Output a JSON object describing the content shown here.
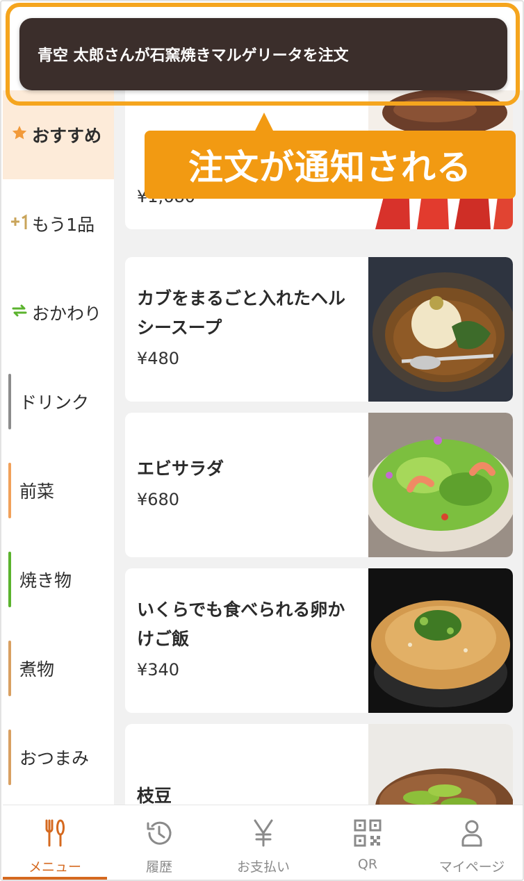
{
  "notification": {
    "message": "青空 太郎さんが石窯焼きマルゲリータを注文",
    "callout": "注文が通知される"
  },
  "sidebar": {
    "items": [
      {
        "label": "おすすめ",
        "icon": "star-icon",
        "active": true
      },
      {
        "label": "もう1品",
        "icon": "plus-one-icon"
      },
      {
        "label": "おかわり",
        "icon": "refresh-icon"
      },
      {
        "label": "ドリンク",
        "bar_color": "#8c8c8c"
      },
      {
        "label": "前菜",
        "bar_color": "#f1a15a"
      },
      {
        "label": "焼き物",
        "bar_color": "#5bb32e"
      },
      {
        "label": "煮物",
        "bar_color": "#d9a062"
      },
      {
        "label": "おつまみ",
        "bar_color": "#d9a062"
      }
    ]
  },
  "menu": {
    "items": [
      {
        "name": "",
        "price": "¥1,680"
      },
      {
        "name": "カブをまるごと入れたヘルシースープ",
        "price": "¥480"
      },
      {
        "name": "エビサラダ",
        "price": "¥680"
      },
      {
        "name": "いくらでも食べられる卵かけご飯",
        "price": "¥340"
      },
      {
        "name": "枝豆",
        "price": ""
      }
    ]
  },
  "tabbar": {
    "tabs": [
      {
        "label": "メニュー",
        "icon": "fork-knife-icon",
        "active": true
      },
      {
        "label": "履歴",
        "icon": "history-icon"
      },
      {
        "label": "お支払い",
        "icon": "yen-icon"
      },
      {
        "label": "QR",
        "icon": "qr-code-icon"
      },
      {
        "label": "マイページ",
        "icon": "user-icon"
      }
    ]
  },
  "colors": {
    "accent": "#d5691f",
    "highlight": "#f29a12",
    "toast_bg": "#3b2e2b",
    "active_sidebar_bg": "#fdebd9"
  }
}
